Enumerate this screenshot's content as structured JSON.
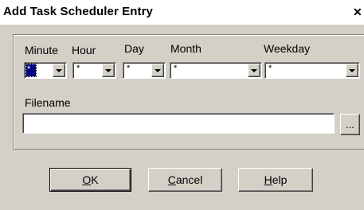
{
  "window": {
    "title": "Add Task Scheduler Entry",
    "close_glyph": "✕"
  },
  "schedule": {
    "minute_label": "Minute",
    "hour_label": "Hour",
    "day_label": "Day",
    "month_label": "Month",
    "weekday_label": "Weekday",
    "minute_value": "*",
    "hour_value": "*",
    "day_value": "*",
    "month_value": "*",
    "weekday_value": "*"
  },
  "file": {
    "filename_label": "Filename",
    "filename_value": "",
    "browse_label": "..."
  },
  "buttons": {
    "ok_accel": "O",
    "ok_rest": "K",
    "cancel_accel": "C",
    "cancel_rest": "ancel",
    "help_accel": "H",
    "help_rest": "elp"
  }
}
